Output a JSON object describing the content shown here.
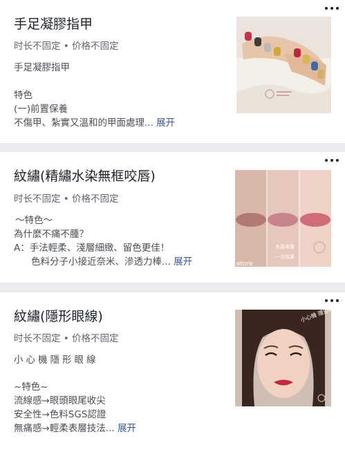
{
  "services": [
    {
      "title": "手足凝膠指甲",
      "meta": "时长不固定 • 价格不固定",
      "subtitle": "手足凝膠指甲",
      "desc_lines": [
        "特色",
        "(一)前置保養",
        "不傷甲、紮實又溫和的甲面處理... "
      ],
      "expand": "展开",
      "image_icon": "nail-art-photo"
    },
    {
      "title": "紋繡(精繡水染無框咬唇)",
      "meta": "时长不固定 • 价格不固定",
      "desc_lines": [
        "～特色～",
        "為什麼不痛不腫？",
        "A：手法輕柔、淺層細緻、留色更佳！",
        "色料分子小接近奈米、滲透力棒... "
      ],
      "expand": "展开",
      "image_caption_1": "水晶漸層",
      "image_caption_2": "一次效果",
      "image_watermark": "etore",
      "image_icon": "lip-tattoo-photo"
    },
    {
      "title": "紋繡(隱形眼線)",
      "meta": "时长不固定 • 价格不固定",
      "subtitle": "小心機隱形眼線",
      "desc_lines": [
        "~特色~",
        "流線感→眼頭眼尾收尖",
        "安全性→色料SGS認證",
        "無痛感→輕柔表層技法... "
      ],
      "expand": "展开",
      "image_caption": "小心機 隱形眼線",
      "image_icon": "eyeliner-portrait-photo"
    }
  ],
  "colors": {
    "background": "#e9ebee",
    "card": "#ffffff",
    "link": "#385898",
    "title": "#1d2129",
    "meta": "#606770"
  }
}
